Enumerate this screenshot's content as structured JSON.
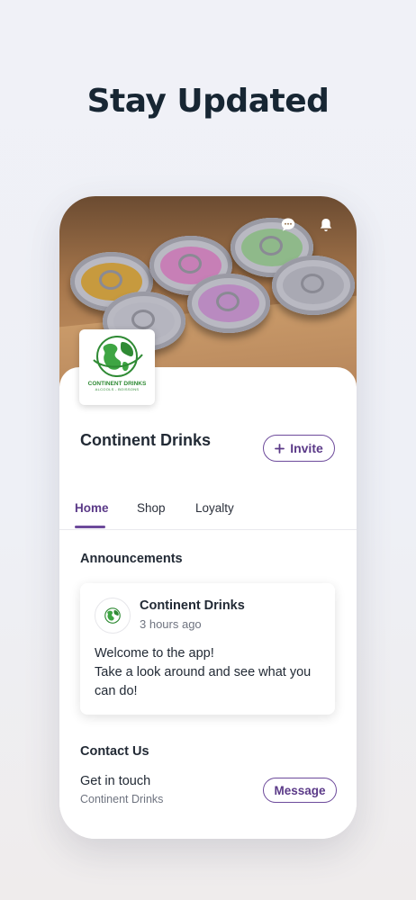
{
  "headline": "Stay Updated",
  "header": {
    "icons": [
      "chat-icon",
      "bell-icon"
    ]
  },
  "business": {
    "name": "Continent Drinks",
    "logo_text": "CONTINENT DRINKS",
    "logo_subtext": "ALCOOLS - BOISSONS",
    "invite_label": "Invite"
  },
  "tabs": [
    {
      "label": "Home",
      "active": true
    },
    {
      "label": "Shop",
      "active": false
    },
    {
      "label": "Loyalty",
      "active": false
    }
  ],
  "announcements": {
    "title": "Announcements",
    "post": {
      "author": "Continent Drinks",
      "time": "3 hours ago",
      "line1": "Welcome to the app!",
      "line2": "Take a look around and see what you can do!"
    }
  },
  "contact": {
    "title": "Contact Us",
    "line": "Get in touch",
    "sub": "Continent Drinks",
    "button_label": "Message"
  },
  "colors": {
    "accent": "#6d4a9b",
    "logo_green": "#2f8a34"
  }
}
